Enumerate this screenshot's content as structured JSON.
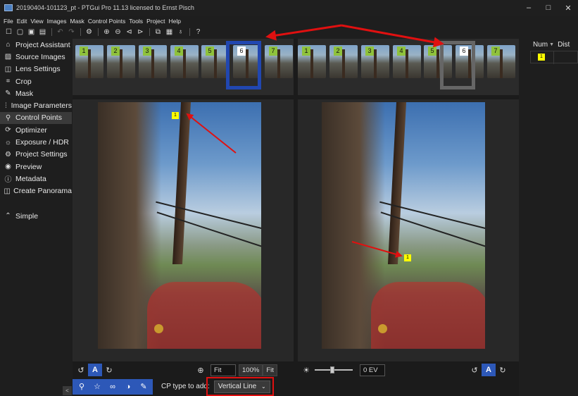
{
  "window": {
    "title": "20190404-101123_pt - PTGui Pro 11.13 licensed to Ernst Pisch",
    "minimize": "–",
    "maximize": "□",
    "close": "✕"
  },
  "menu": [
    "File",
    "Edit",
    "View",
    "Images",
    "Mask",
    "Control Points",
    "Tools",
    "Project",
    "Help"
  ],
  "sidebar": {
    "items": [
      {
        "label": "Project Assistant",
        "icon": "home-icon",
        "glyph": "⌂"
      },
      {
        "label": "Source Images",
        "icon": "image-icon",
        "glyph": "▨"
      },
      {
        "label": "Lens Settings",
        "icon": "camera-icon",
        "glyph": "◫"
      },
      {
        "label": "Crop",
        "icon": "crop-icon",
        "glyph": "⌗"
      },
      {
        "label": "Mask",
        "icon": "brush-icon",
        "glyph": "✎"
      },
      {
        "label": "Image Parameters",
        "icon": "sliders-icon",
        "glyph": "⫶"
      },
      {
        "label": "Control Points",
        "icon": "control-points-icon",
        "glyph": "⚲"
      },
      {
        "label": "Optimizer",
        "icon": "optimizer-icon",
        "glyph": "⟳"
      },
      {
        "label": "Exposure / HDR",
        "icon": "sun-icon",
        "glyph": "☼"
      },
      {
        "label": "Project Settings",
        "icon": "gear-icon",
        "glyph": "⚙"
      },
      {
        "label": "Preview",
        "icon": "eye-icon",
        "glyph": "◉"
      },
      {
        "label": "Metadata",
        "icon": "info-icon",
        "glyph": "ⓘ"
      },
      {
        "label": "Create Panorama",
        "icon": "panorama-icon",
        "glyph": "◫"
      }
    ],
    "active_index": 6,
    "simple": {
      "label": "Simple",
      "icon": "chevron-up-circle-icon",
      "glyph": "⌃"
    }
  },
  "left_panel": {
    "thumbnails": [
      "1",
      "2",
      "3",
      "4",
      "5",
      "6",
      "7"
    ],
    "selected": "6",
    "control_point_label": "1"
  },
  "right_panel_images": {
    "thumbnails": [
      "1",
      "2",
      "3",
      "4",
      "5",
      "6",
      "7"
    ],
    "selected": "6",
    "control_point_label": "1"
  },
  "view_controls": {
    "zoom_value": "Fit",
    "zoom_100": "100%",
    "zoom_fit": "Fit",
    "auto_label": "A",
    "ev_value": "0 EV"
  },
  "bottom": {
    "cp_type_label": "CP type to add:",
    "cp_type_value": "Vertical Line"
  },
  "cp_list": {
    "columns": [
      "Num",
      "Dist"
    ],
    "rows": [
      {
        "num": "1",
        "dist": ""
      }
    ]
  },
  "colors": {
    "accent": "#2d58b8",
    "selected_image_border": "#2147b0",
    "annotation_red": "#e01010",
    "cp_marker": "#ffff00",
    "thumb_badge": "#8fc23c"
  }
}
